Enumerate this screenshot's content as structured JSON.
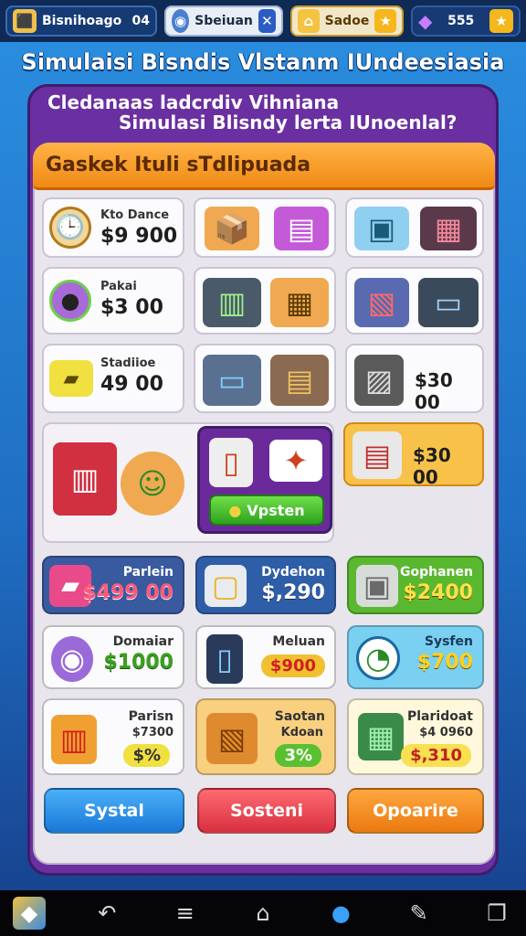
{
  "topbar": {
    "player_label": "Bisnihoago",
    "player_level": "04",
    "search_text": "Sbeiuan",
    "gold_text": "Sadoe",
    "gems_count": "555"
  },
  "title": "Simulaisi Bisndis Vlstanm IUndeesiasia",
  "panel": {
    "subtitle_line1": "Cledanaas ladcrdiv Vihniana",
    "subtitle_line2": "Simulasi Blisndy lerta IUnoenlal?",
    "banner": "Gaskek Ituli sTdlipuada"
  },
  "upgrades": [
    {
      "label": "Kto Dance",
      "price": "$9 900"
    },
    {
      "label": "Pakai",
      "price": "$3 00"
    },
    {
      "label": "Stadiioe",
      "price": "49 00"
    }
  ],
  "right_price_1": "$30 00",
  "right_price_2": "$30 00",
  "system_button": "Vpsten",
  "shop": [
    {
      "name": "Parlein",
      "price": "$499 00"
    },
    {
      "name": "Dydehon",
      "price": "$,290"
    },
    {
      "name": "Gophanen",
      "price": "$2400"
    },
    {
      "name": "Domaiar",
      "price": "$1000"
    },
    {
      "name": "Meluan",
      "price": "$900"
    },
    {
      "name": "Sysfen",
      "price": "$700"
    },
    {
      "name": "Parisn",
      "sub": "$7300",
      "price": "$%"
    },
    {
      "name": "Saotan",
      "sub": "Kdoan",
      "price": "3%"
    },
    {
      "name": "Plaridoat",
      "sub": "$4 0960",
      "price": "$,310"
    }
  ],
  "buttons": {
    "left": "Systal",
    "middle": "Sosteni",
    "right": "Opoarire"
  },
  "colors": {
    "panel_purple": "#6a2fa0",
    "banner_orange": "#f08a14",
    "btn_blue": "#2e8fe6",
    "btn_red": "#e8474f",
    "btn_orange": "#f58a1a"
  }
}
